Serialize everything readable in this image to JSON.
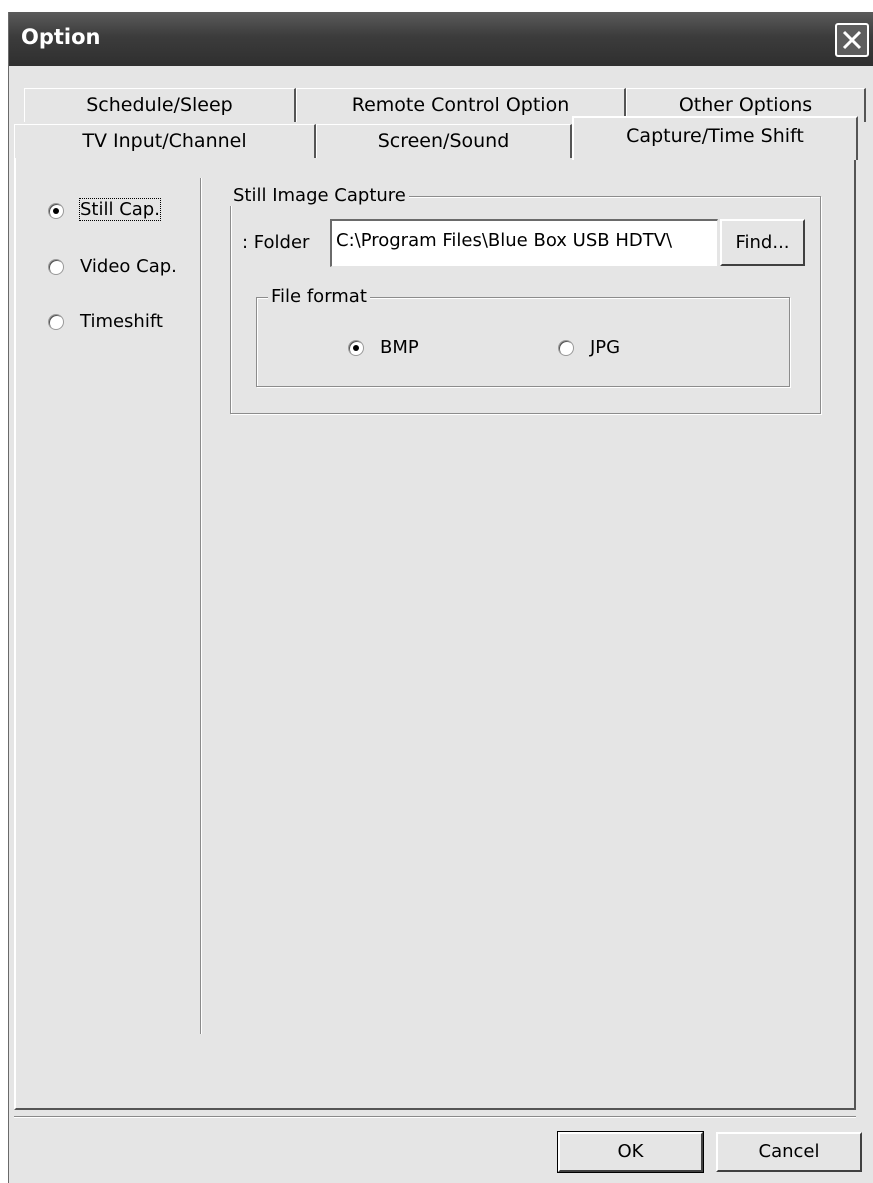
{
  "window": {
    "title": "Option"
  },
  "tabs": {
    "back_row": [
      "Schedule/Sleep",
      "Remote Control Option",
      "Other Options"
    ],
    "front_row": [
      "TV Input/Channel",
      "Screen/Sound",
      "Capture/Time Shift"
    ],
    "active": "Capture/Time Shift"
  },
  "capture_modes": [
    {
      "label": "Still Cap.",
      "selected": true
    },
    {
      "label": "Video Cap.",
      "selected": false
    },
    {
      "label": "Timeshift",
      "selected": false
    }
  ],
  "still_capture": {
    "group_title": "Still Image Capture",
    "folder_label": ": Folder",
    "folder_value": "C:\\Program Files\\Blue Box USB HDTV\\",
    "find_label": "Find...",
    "format_group_title": "File format",
    "formats": [
      {
        "label": "BMP",
        "selected": true
      },
      {
        "label": "JPG",
        "selected": false
      }
    ]
  },
  "footer": {
    "ok_label": "OK",
    "cancel_label": "Cancel"
  }
}
